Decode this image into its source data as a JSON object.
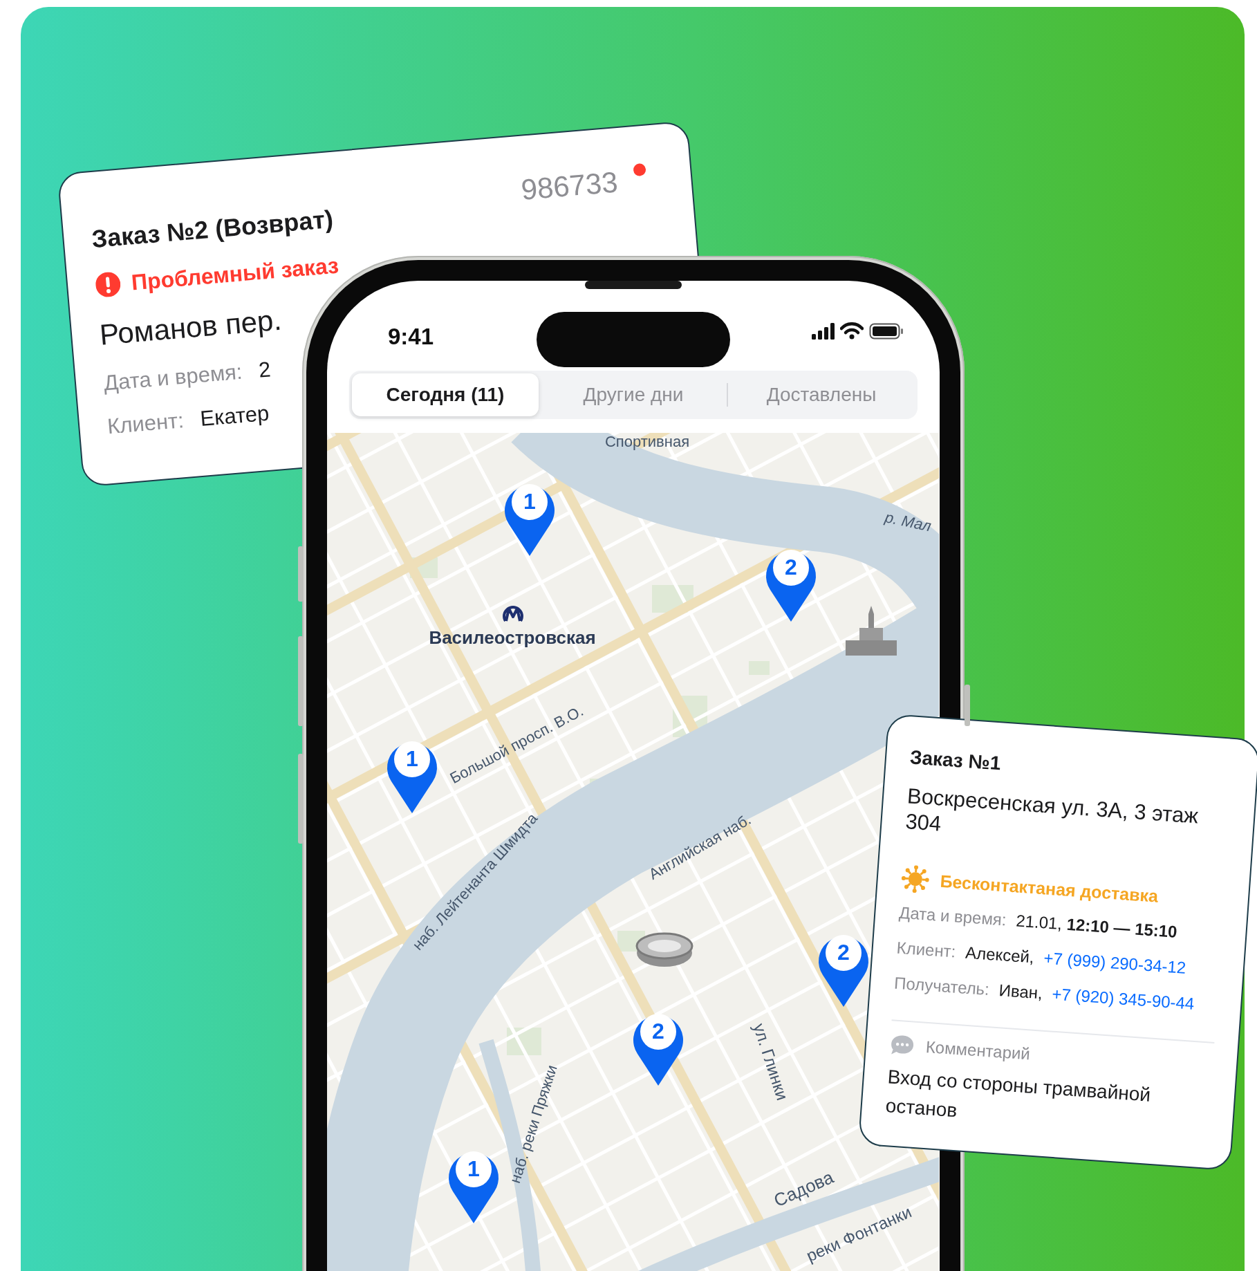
{
  "back_card": {
    "title": "Заказ №2 (Возврат)",
    "order_number": "986733",
    "alert": "Проблемный заказ",
    "address": "Романов пер.",
    "fields": [
      {
        "label": "Дата и время:",
        "value": "2"
      },
      {
        "label": "Клиент:",
        "value": "Екатер"
      }
    ]
  },
  "phone": {
    "time": "9:41",
    "tabs": [
      {
        "label": "Сегодня (11)",
        "selected": true
      },
      {
        "label": "Другие дни",
        "selected": false
      },
      {
        "label": "Доставлены",
        "selected": false
      }
    ],
    "map": {
      "metro_station": "Василеостровская",
      "street_labels": [
        "Спортивная",
        "р. Мал",
        "Большой просп. В.О.",
        "наб. Лейтенанта Шмидта",
        "Английская наб.",
        "ул. Глинки",
        "наб. реки Пряжки",
        "Садова",
        "реки Фонтанки"
      ],
      "pins": [
        {
          "number": "1"
        },
        {
          "number": "2"
        },
        {
          "number": "1"
        },
        {
          "number": "2"
        },
        {
          "number": "2"
        },
        {
          "number": "1"
        }
      ]
    }
  },
  "front_card": {
    "title": "Заказ №1",
    "address": "Воскресенская ул. 3А, 3 этаж 304",
    "delivery_note": "Бесконтактаная доставка",
    "fields": [
      {
        "label": "Дата и время:",
        "value": "21.01, **12:10 — 15:10**"
      },
      {
        "label": "Клиент:",
        "value": "Алексей,",
        "phone": "+7 (999) 290-34-12"
      },
      {
        "label": "Получатель:",
        "value": "Иван,",
        "phone": "+7 (920) 345-90-44"
      }
    ],
    "comment_label": "Комментарий",
    "comment": "Вход со стороны трамвайной останов"
  }
}
